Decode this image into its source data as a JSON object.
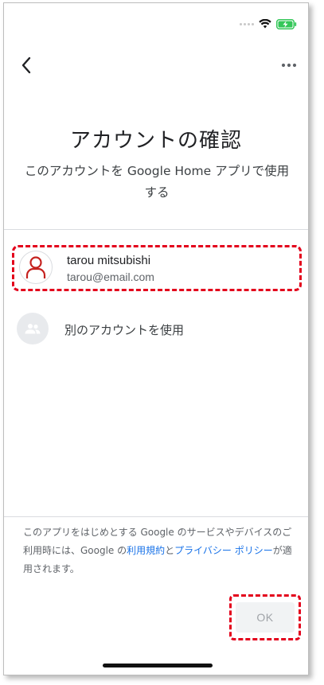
{
  "header": {
    "title": "アカウントの確認",
    "subtitle": "このアカウントを Google Home アプリで使用する"
  },
  "account": {
    "name": "tarou mitsubishi",
    "email": "tarou@email.com"
  },
  "other_account": {
    "label": "別のアカウントを使用"
  },
  "footer": {
    "text_part1": "このアプリをはじめとする Google のサービスやデバイスのご利用時には、Google の",
    "terms_link": "利用規約",
    "text_part2": "と",
    "privacy_link": "プライバシー ポリシー",
    "text_part3": "が適用されます。"
  },
  "actions": {
    "ok_label": "OK"
  },
  "colors": {
    "highlight": "#e3001b",
    "link": "#1a73e8",
    "avatar": "#c5221f",
    "battery": "#34c759"
  },
  "icons": {
    "back": "chevron-left-icon",
    "more": "more-horizontal-icon",
    "avatar": "person-icon",
    "other_account": "people-icon",
    "wifi": "wifi-icon",
    "battery": "battery-charging-icon"
  }
}
